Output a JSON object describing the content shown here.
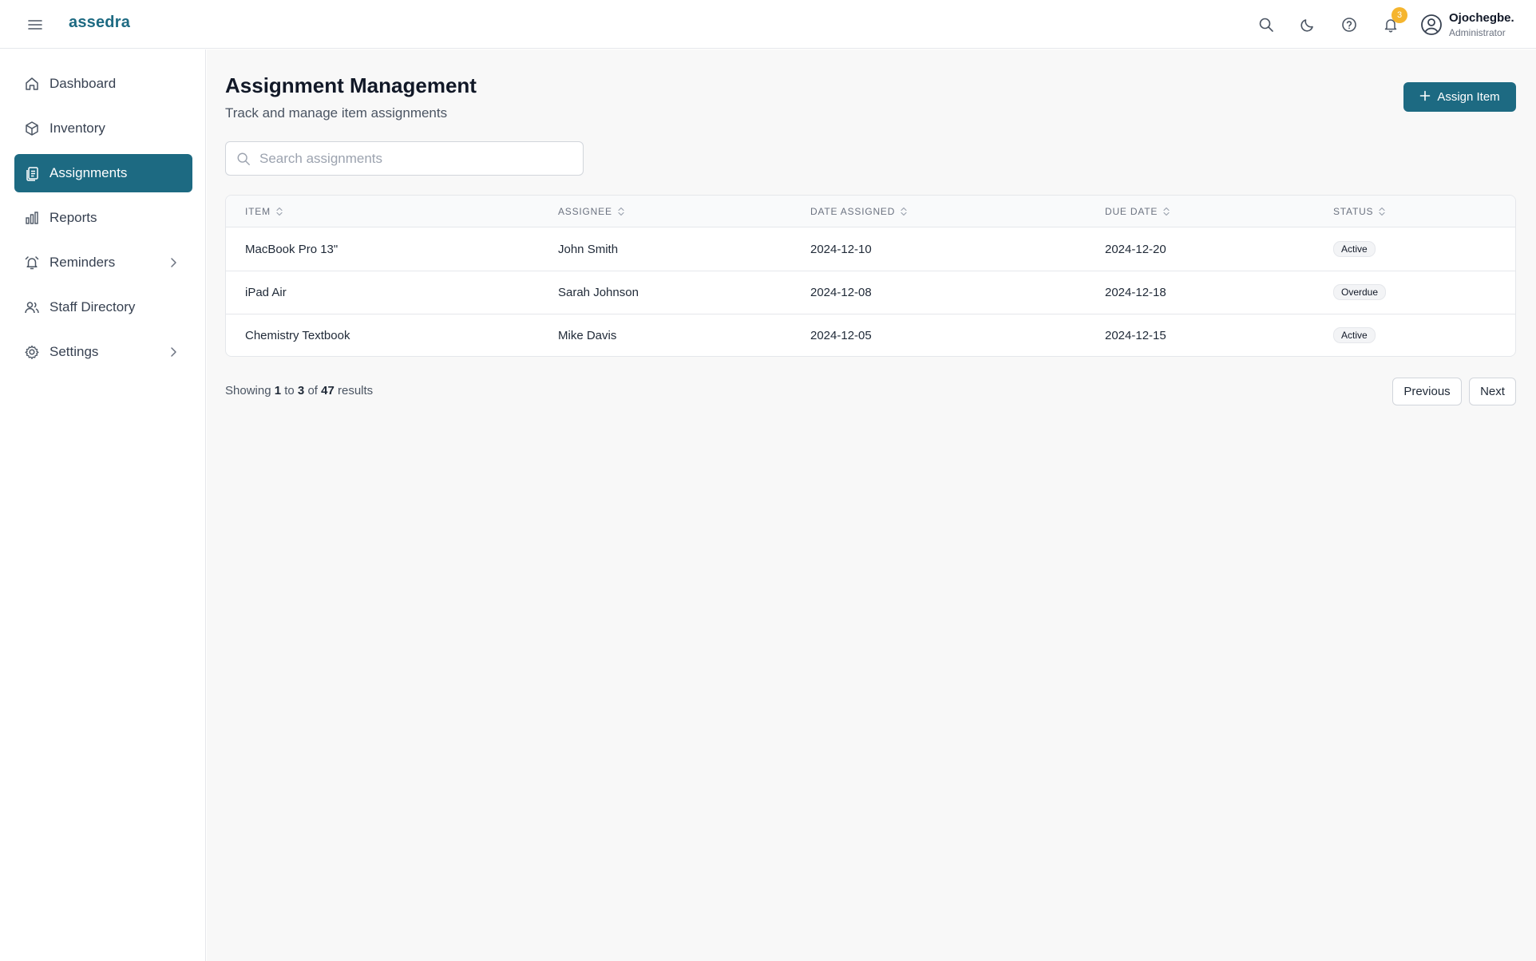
{
  "brand": {
    "logo_text": "assedra",
    "accent_color": "#1d6a82"
  },
  "header": {
    "notification_count": "3",
    "user": {
      "name": "Ojochegbe.",
      "role": "Administrator"
    },
    "icons": [
      "menu-icon",
      "search-icon",
      "moon-icon",
      "help-icon",
      "bell-icon",
      "user-circle-icon"
    ]
  },
  "sidebar": {
    "items": [
      {
        "label": "Dashboard",
        "icon": "home-icon",
        "active": false
      },
      {
        "label": "Inventory",
        "icon": "box-icon",
        "active": false
      },
      {
        "label": "Assignments",
        "icon": "clipboard-icon",
        "active": true
      },
      {
        "label": "Reports",
        "icon": "bar-chart-icon",
        "active": false
      },
      {
        "label": "Reminders",
        "icon": "alarm-icon",
        "active": false,
        "expandable": true
      },
      {
        "label": "Staff Directory",
        "icon": "users-icon",
        "active": false
      },
      {
        "label": "Settings",
        "icon": "gear-icon",
        "active": false,
        "expandable": true
      }
    ]
  },
  "main": {
    "title": "Assignment Management",
    "subtitle": "Track and manage item assignments",
    "assign_button": "Assign Item",
    "search": {
      "placeholder": "Search assignments",
      "value": ""
    },
    "table": {
      "columns": [
        "ITEM",
        "ASSIGNEE",
        "DATE ASSIGNED",
        "DUE DATE",
        "STATUS"
      ],
      "rows": [
        {
          "item": "MacBook Pro 13\"",
          "assignee": "John Smith",
          "date_assigned": "2024-12-10",
          "due_date": "2024-12-20",
          "status": "Active"
        },
        {
          "item": "iPad Air",
          "assignee": "Sarah Johnson",
          "date_assigned": "2024-12-08",
          "due_date": "2024-12-18",
          "status": "Overdue"
        },
        {
          "item": "Chemistry Textbook",
          "assignee": "Mike Davis",
          "date_assigned": "2024-12-05",
          "due_date": "2024-12-15",
          "status": "Active"
        }
      ]
    },
    "pagination": {
      "prefix": "Showing",
      "from": "1",
      "to_word": "to",
      "to": "3",
      "of_word": "of",
      "total": "47",
      "suffix": "results",
      "previous_label": "Previous",
      "next_label": "Next"
    }
  }
}
